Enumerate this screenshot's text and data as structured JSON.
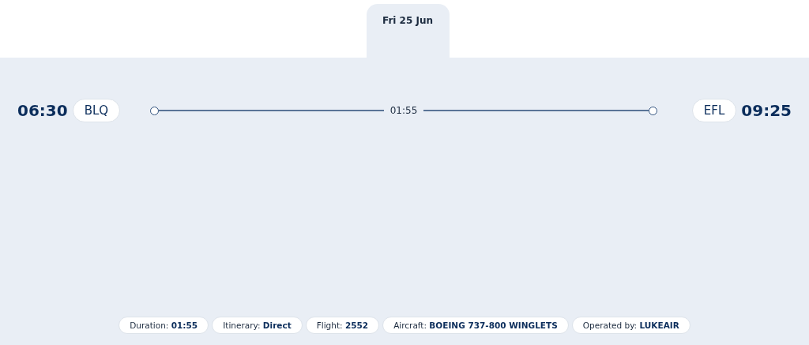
{
  "date_tab": {
    "label": "Fri 25 Jun",
    "selected": true
  },
  "departure": {
    "time": "06:30",
    "airport": "BLQ"
  },
  "duration": "01:55",
  "arrival": {
    "airport": "EFL",
    "time": "09:25"
  },
  "details": [
    {
      "label": "Duration:",
      "value": "01:55"
    },
    {
      "label": "Itinerary:",
      "value": "Direct"
    },
    {
      "label": "Flight:",
      "value": "2552"
    },
    {
      "label": "Aircraft:",
      "value": "BOEING 737-800 WINGLETS"
    },
    {
      "label": "Operated by:",
      "value": "LUKEAIR"
    }
  ]
}
